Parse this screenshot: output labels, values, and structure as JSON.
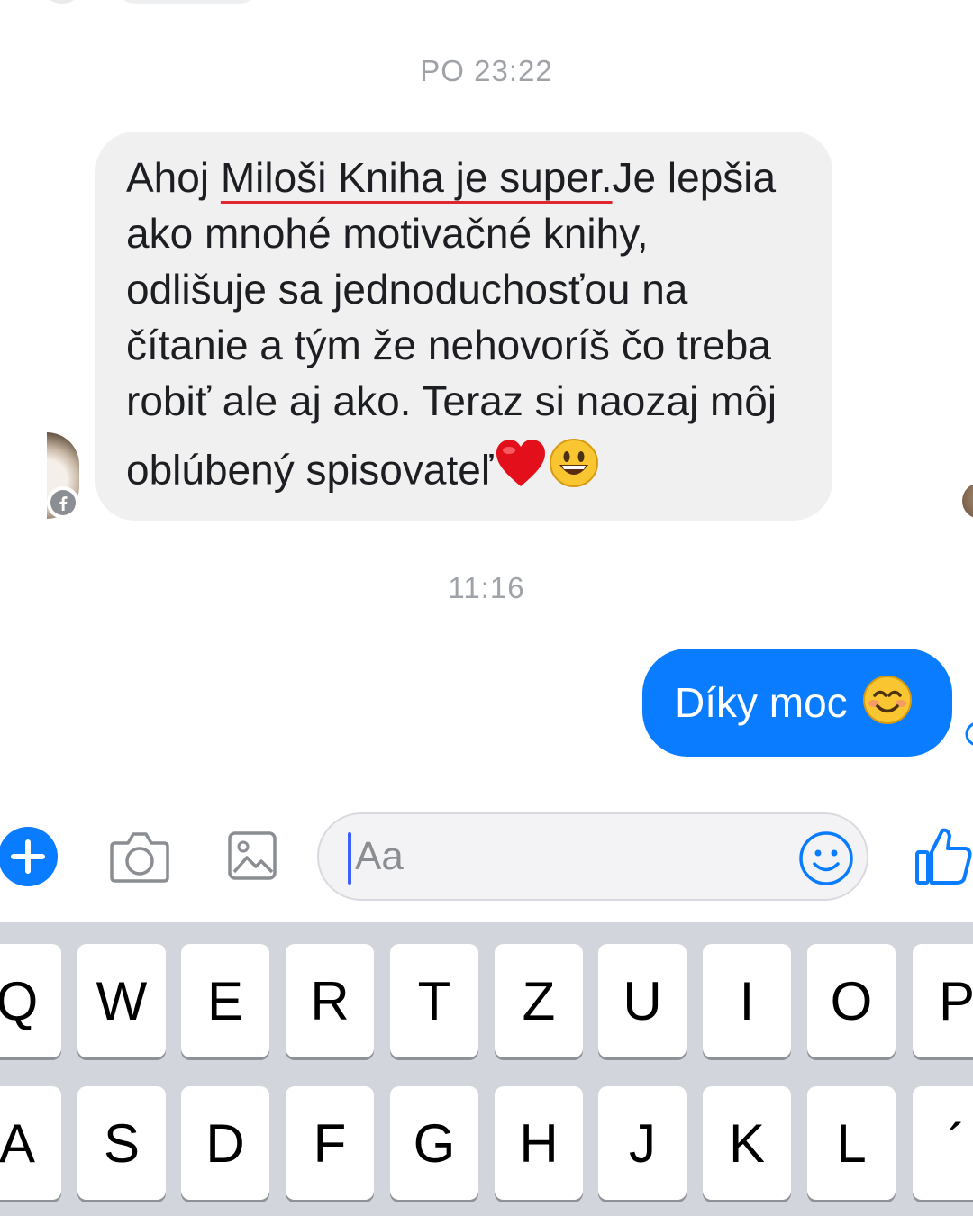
{
  "conversation": {
    "timestamp_1": "PO 23:22",
    "incoming_message": {
      "lines": [
        {
          "pre": "Ahoj ",
          "underlined": "Miloši Kniha je super.",
          "post": "Je lepšia"
        },
        {
          "text": "ako mnohé motivačné knihy,"
        },
        {
          "text": "odlišuje sa jednoduchosťou na"
        },
        {
          "text": "čítanie a tým že nehovoríš čo treba"
        },
        {
          "text": "robiť ale aj ako. Teraz si naozaj môj"
        },
        {
          "text": "oblúbený spisovateľ"
        }
      ],
      "emojis": [
        "red-heart",
        "grinning-face"
      ]
    },
    "timestamp_2": "11:16",
    "outgoing_message": {
      "text": "Díky moc",
      "emoji": "smiling-face-with-smiling-eyes"
    }
  },
  "composer": {
    "placeholder": "Aa",
    "accent_color": "#0a7cff",
    "icons": [
      "plus-icon",
      "camera-icon",
      "image-icon",
      "smiley-icon",
      "thumbs-up-icon"
    ]
  },
  "keyboard": {
    "row1": [
      "Q",
      "W",
      "E",
      "R",
      "T",
      "Z",
      "U",
      "I",
      "O",
      "P"
    ],
    "row2": [
      "A",
      "S",
      "D",
      "F",
      "G",
      "H",
      "J",
      "K",
      "L",
      "´"
    ]
  }
}
